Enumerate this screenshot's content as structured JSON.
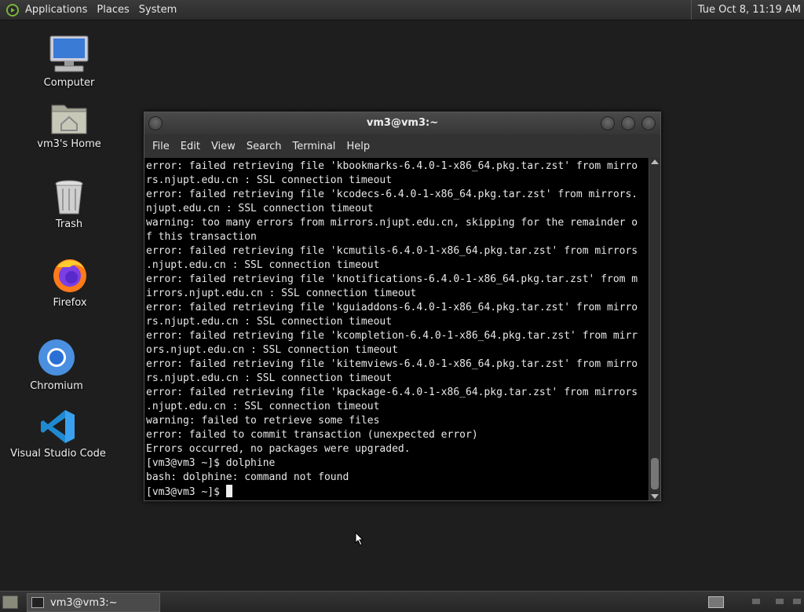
{
  "top_panel": {
    "menus": [
      "Applications",
      "Places",
      "System"
    ],
    "clock": "Tue Oct  8, 11:19 AM"
  },
  "desktop_icons": [
    {
      "label": "Computer",
      "icon": "computer-icon"
    },
    {
      "label": "vm3's Home",
      "icon": "home-folder-icon"
    },
    {
      "label": "Trash",
      "icon": "trash-icon"
    },
    {
      "label": "Firefox",
      "icon": "firefox-icon"
    },
    {
      "label": "Chromium",
      "icon": "chromium-icon"
    },
    {
      "label": "Visual Studio Code",
      "icon": "vscode-icon"
    }
  ],
  "terminal": {
    "title": "vm3@vm3:~",
    "menu": [
      "File",
      "Edit",
      "View",
      "Search",
      "Terminal",
      "Help"
    ],
    "lines": [
      "error: failed retrieving file 'kbookmarks-6.4.0-1-x86_64.pkg.tar.zst' from mirro",
      "rs.njupt.edu.cn : SSL connection timeout",
      "error: failed retrieving file 'kcodecs-6.4.0-1-x86_64.pkg.tar.zst' from mirrors.",
      "njupt.edu.cn : SSL connection timeout",
      "warning: too many errors from mirrors.njupt.edu.cn, skipping for the remainder o",
      "f this transaction",
      "error: failed retrieving file 'kcmutils-6.4.0-1-x86_64.pkg.tar.zst' from mirrors",
      ".njupt.edu.cn : SSL connection timeout",
      "error: failed retrieving file 'knotifications-6.4.0-1-x86_64.pkg.tar.zst' from m",
      "irrors.njupt.edu.cn : SSL connection timeout",
      "error: failed retrieving file 'kguiaddons-6.4.0-1-x86_64.pkg.tar.zst' from mirro",
      "rs.njupt.edu.cn : SSL connection timeout",
      "error: failed retrieving file 'kcompletion-6.4.0-1-x86_64.pkg.tar.zst' from mirr",
      "ors.njupt.edu.cn : SSL connection timeout",
      "error: failed retrieving file 'kitemviews-6.4.0-1-x86_64.pkg.tar.zst' from mirro",
      "rs.njupt.edu.cn : SSL connection timeout",
      "error: failed retrieving file 'kpackage-6.4.0-1-x86_64.pkg.tar.zst' from mirrors",
      ".njupt.edu.cn : SSL connection timeout",
      "warning: failed to retrieve some files",
      "error: failed to commit transaction (unexpected error)",
      "Errors occurred, no packages were upgraded.",
      "[vm3@vm3 ~]$ dolphine",
      "bash: dolphine: command not found"
    ],
    "prompt": "[vm3@vm3 ~]$ "
  },
  "taskbar": {
    "task_label": "vm3@vm3:~"
  }
}
